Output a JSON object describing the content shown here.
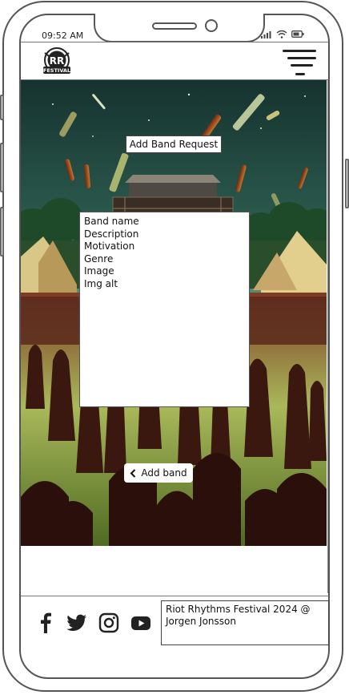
{
  "status_bar": {
    "time": "09:52 AM"
  },
  "header": {
    "logo_text": "RR",
    "logo_subtext": "FESTIVAL",
    "menu_icon": "hamburger-menu-icon"
  },
  "hero": {
    "image_alt": "Crowd dancing at a rock festival with flying bottles"
  },
  "page": {
    "title": "Add Band Request",
    "form_fields": [
      "Band name",
      "Description",
      "Motivation",
      "Genre",
      "Image",
      "Img alt"
    ],
    "add_button_label": "Add band",
    "add_button_icon": "chevron-left-icon"
  },
  "footer": {
    "social_icons": [
      "facebook-icon",
      "twitter-icon",
      "instagram-icon",
      "youtube-icon"
    ],
    "copyright": "Riot Rhythms Festival 2024 @ Jorgen Jonsson"
  },
  "colors": {
    "frame": "#555555",
    "sky_top": "#1b3a3a",
    "grass": "#6f8f3a",
    "crowd": "#3a1a14"
  }
}
